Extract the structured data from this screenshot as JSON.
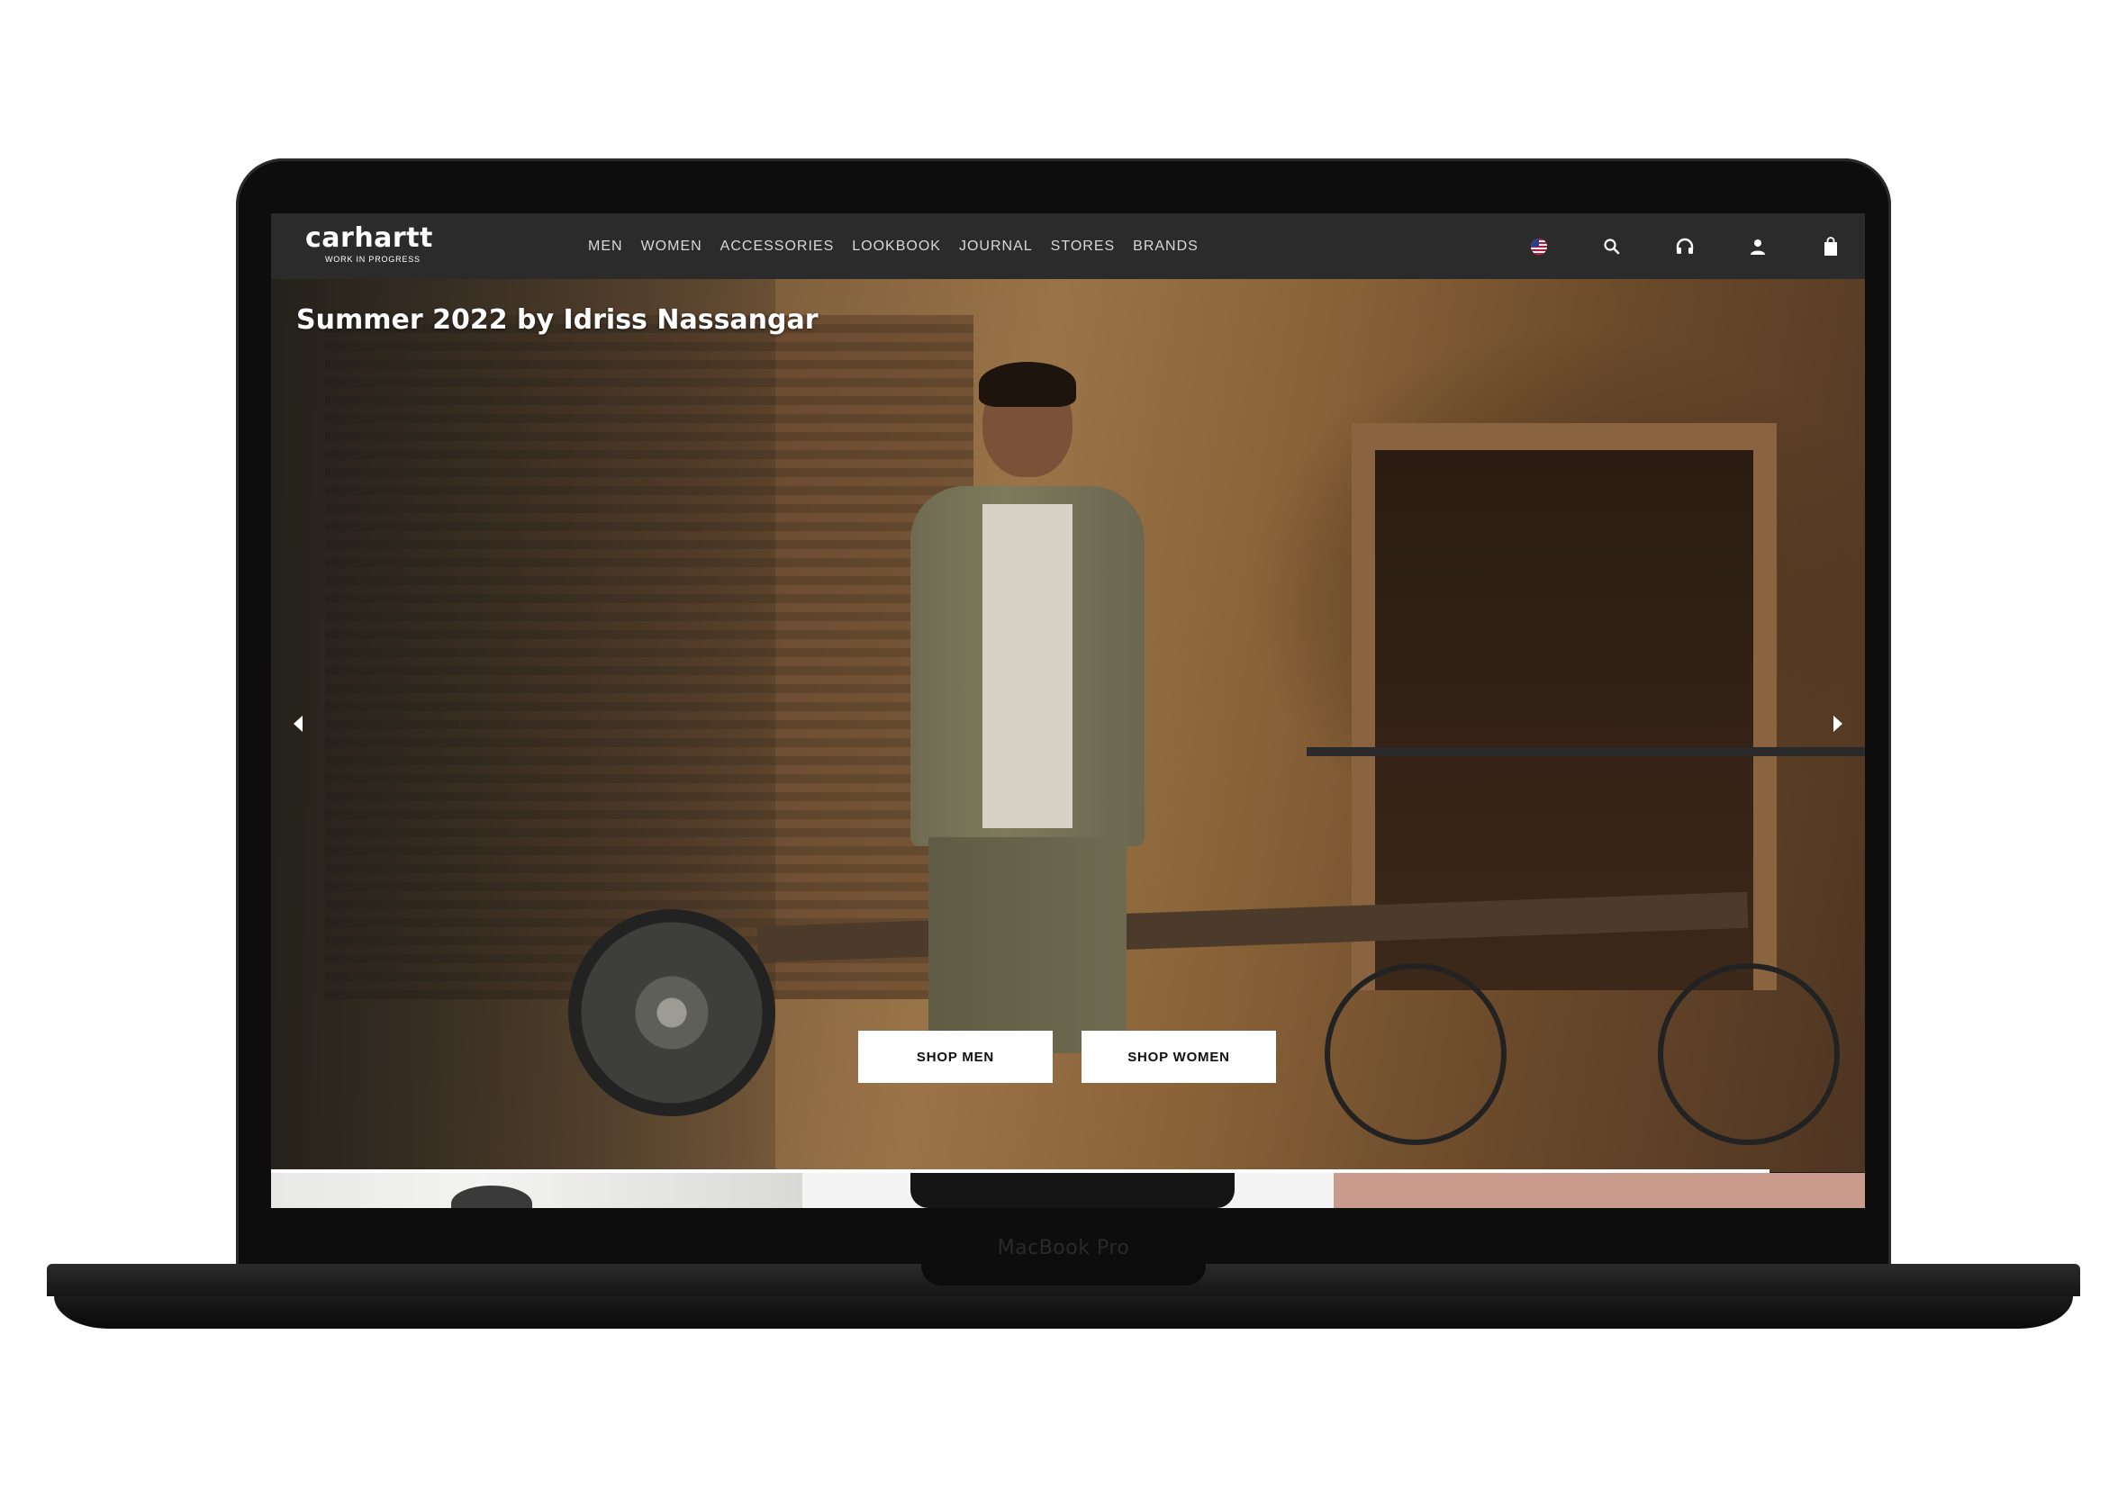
{
  "device": {
    "bezel_label": "MacBook Pro"
  },
  "navbar": {
    "logo_main": "carhartt",
    "logo_sub": "WORK IN PROGRESS",
    "menu": [
      {
        "label": "MEN"
      },
      {
        "label": "WOMEN"
      },
      {
        "label": "ACCESSORIES"
      },
      {
        "label": "LOOKBOOK"
      },
      {
        "label": "JOURNAL"
      },
      {
        "label": "STORES"
      },
      {
        "label": "BRANDS"
      }
    ],
    "icons": [
      "us-flag-icon",
      "search-icon",
      "headphones-icon",
      "account-icon",
      "shopping-bag-icon"
    ]
  },
  "hero": {
    "title": "Summer 2022 by Idriss Nassangar",
    "shop_men_label": "SHOP MEN",
    "shop_women_label": "SHOP WOMEN",
    "slide_progress": 0.94
  },
  "colors": {
    "navbar_bg": "#2b2b2b",
    "nav_text": "#d8d8d8",
    "button_bg": "#ffffff",
    "button_text": "#111111"
  }
}
